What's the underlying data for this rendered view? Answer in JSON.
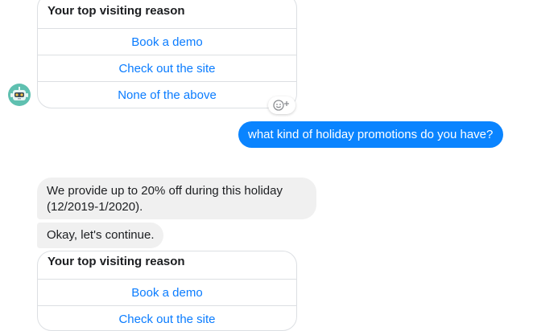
{
  "cards": [
    {
      "title": "Your top visiting reason",
      "options": [
        "Book a demo",
        "Check out the site",
        "None of the above"
      ]
    },
    {
      "title": "Your top visiting reason",
      "options": [
        "Book a demo",
        "Check out the site"
      ]
    }
  ],
  "user_message": "what kind of holiday promotions do you have?",
  "bot_messages": [
    "We provide up to 20% off during this holiday (12/2019-1/2020).",
    "Okay, let's continue."
  ],
  "icons": {
    "avatar": "robot-avatar-icon",
    "reaction": "add-reaction-icon"
  },
  "colors": {
    "accent": "#0a84ff",
    "link": "#0a7cff",
    "bot_bubble": "#f0f0f0",
    "border": "#dcdfe3"
  }
}
